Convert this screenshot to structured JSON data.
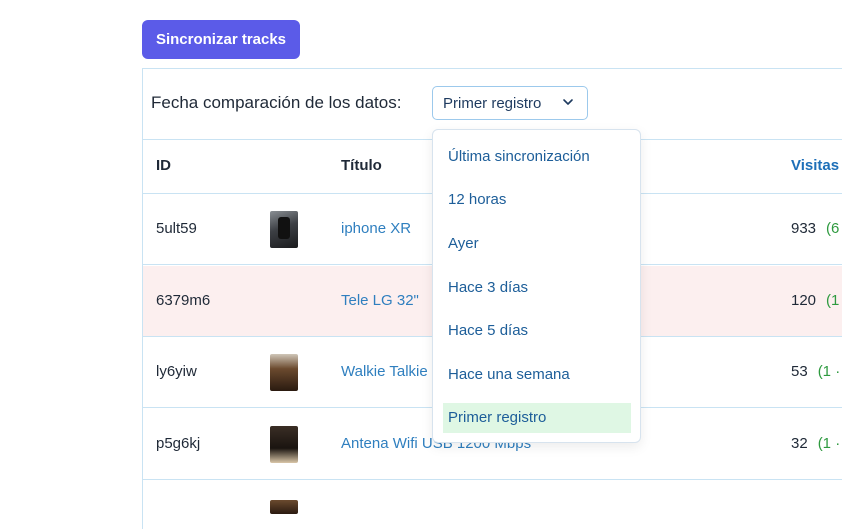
{
  "toolbar": {
    "sync_label": "Sincronizar tracks"
  },
  "filter": {
    "label": "Fecha comparación de los datos:",
    "selected": "Primer registro",
    "options": [
      "Última sincronización",
      "12 horas",
      "Ayer",
      "Hace 3 días",
      "Hace 5 días",
      "Hace una semana",
      "Primer registro"
    ],
    "selected_color": "#dff7e4"
  },
  "table": {
    "headers": {
      "id": "ID",
      "title": "Título",
      "visits": "Visitas"
    },
    "rows": [
      {
        "id": "5ult59",
        "title": "iphone XR",
        "visits": "933",
        "delta": "(6",
        "has_thumb": true,
        "alert": false
      },
      {
        "id": "6379m6",
        "title": "Tele LG 32\"",
        "visits": "120",
        "delta": "(1",
        "has_thumb": false,
        "alert": true
      },
      {
        "id": "ly6yiw",
        "title": "Walkie Talkie",
        "visits": "53",
        "delta": "(1 ·",
        "has_thumb": true,
        "alert": false
      },
      {
        "id": "p5g6kj",
        "title": "Antena Wifi USB 1200 Mbps",
        "visits": "32",
        "delta": "(1 ·",
        "has_thumb": true,
        "alert": false
      }
    ]
  },
  "colors": {
    "accent": "#5b5be8",
    "link": "#2f7fbf",
    "positive": "#2e9a3f",
    "alert_row": "#fcefef",
    "border": "#c9e3f3"
  }
}
